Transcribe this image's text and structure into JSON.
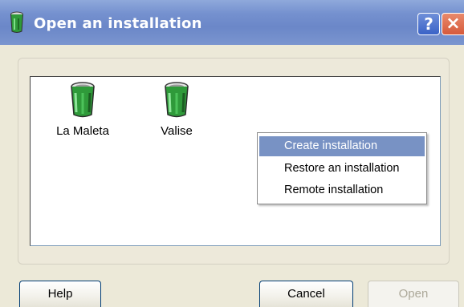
{
  "window": {
    "title": "Open an installation",
    "help_symbol": "?",
    "close_symbol": "×",
    "app_icon": "recycle-bin-icon"
  },
  "list": {
    "items": [
      {
        "label": "La Maleta",
        "icon": "recycle-bin-icon"
      },
      {
        "label": "Valise",
        "icon": "recycle-bin-icon"
      }
    ]
  },
  "context_menu": {
    "items": [
      {
        "label": "Create installation",
        "selected": true
      },
      {
        "label": "Restore an installation",
        "selected": false
      },
      {
        "label": "Remote installation",
        "selected": false
      }
    ]
  },
  "buttons": {
    "help_label": "Help",
    "cancel_label": "Cancel",
    "open_label": "Open",
    "open_enabled": false
  },
  "colors": {
    "titlebar": "#7591cf",
    "menu_highlight": "#7892c4",
    "dialog_bg": "#ece9d8"
  }
}
